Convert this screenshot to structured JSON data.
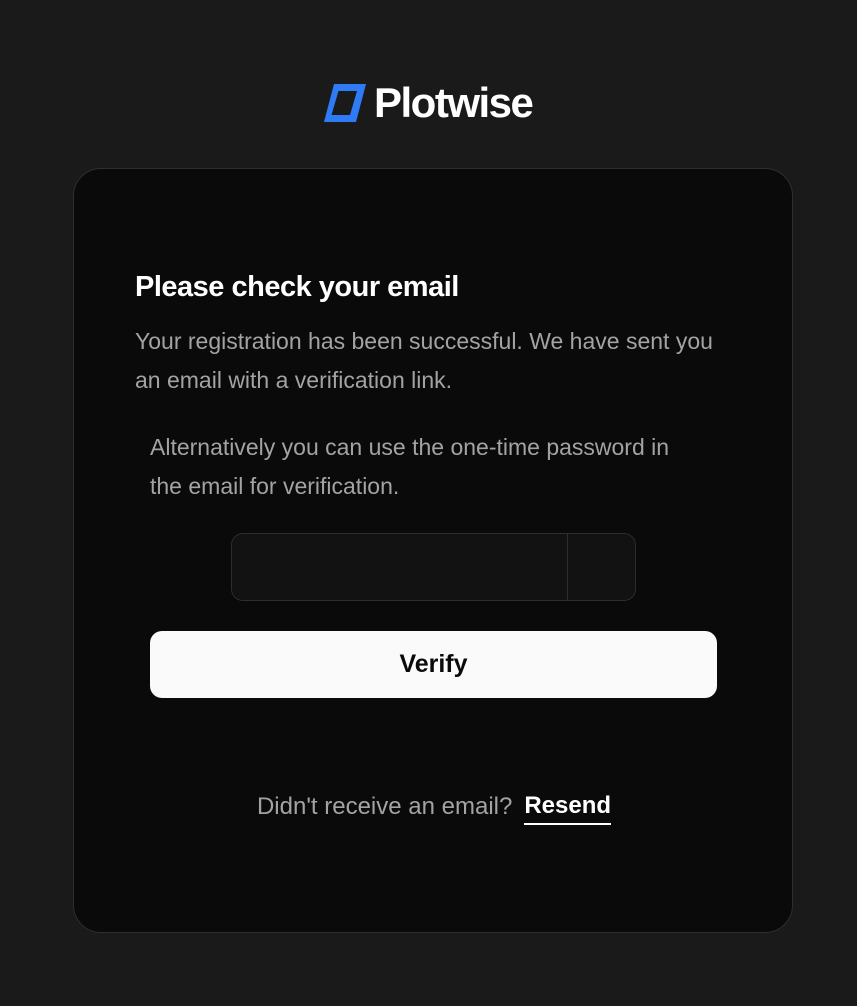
{
  "brand": {
    "name": "Plotwise",
    "logo_icon": "plotwise-logo-icon",
    "accent_color": "#2f7bf6"
  },
  "card": {
    "title": "Please check your email",
    "description": "Your registration has been successful. We have sent you an email with a verification link.",
    "alternative_text": "Alternatively you can use the one-time password in the email for verification.",
    "otp": {
      "digits": [
        "",
        "",
        "",
        "",
        "",
        ""
      ]
    },
    "verify_label": "Verify",
    "resend_prompt": "Didn't receive an email?",
    "resend_label": "Resend"
  },
  "colors": {
    "page_background": "#1a1a1a",
    "card_background": "#0a0a0a",
    "muted_text": "#a3a3a3",
    "button_background": "#fafafa"
  }
}
